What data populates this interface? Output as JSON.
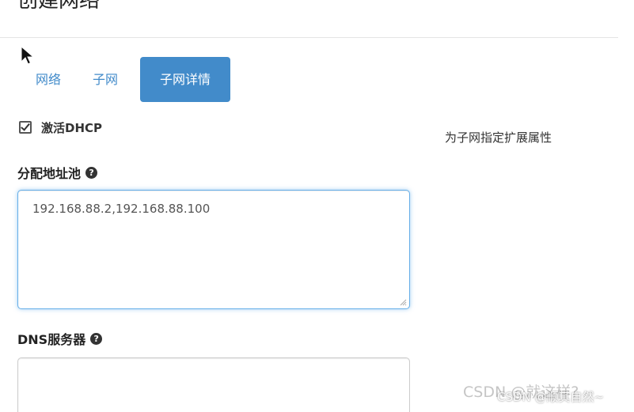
{
  "modal": {
    "title": "创建网络"
  },
  "tabs": [
    {
      "label": "网络",
      "active": false
    },
    {
      "label": "子网",
      "active": false
    },
    {
      "label": "子网详情",
      "active": true
    }
  ],
  "form": {
    "enable_dhcp": {
      "label": "激活DHCP",
      "checked": true
    },
    "allocation_pools": {
      "label": "分配地址池",
      "value": "192.168.88.2,192.168.88.100"
    },
    "dns_servers": {
      "label": "DNS服务器",
      "value": ""
    }
  },
  "side_help": {
    "text": "为子网指定扩展属性"
  },
  "watermark": {
    "text": "CSDN @就这样?",
    "overlay_text": "CSDN @顺其自然~"
  },
  "icons": {
    "help": "question-circle-icon",
    "cursor": "mouse-pointer-icon"
  },
  "colors": {
    "primary": "#428bca",
    "focus_border": "#66afe9"
  }
}
